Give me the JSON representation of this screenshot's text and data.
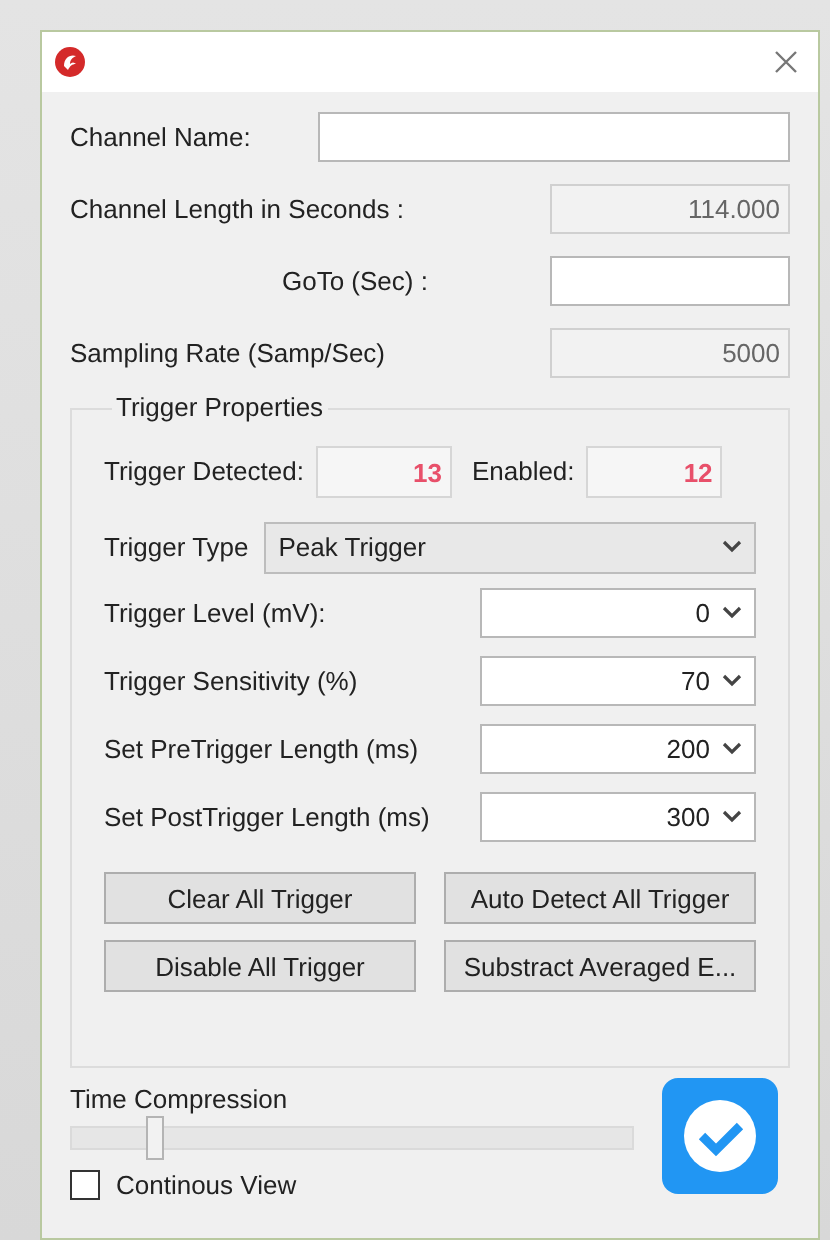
{
  "fields": [
    {
      "label": "Channel Name:",
      "readonly": false,
      "kind": "wide"
    },
    {
      "label": "Channel Length in Seconds :",
      "value": "114.000",
      "readonly": true,
      "kind": "short"
    },
    {
      "label": "GoTo (Sec) :",
      "readonly": false,
      "kind": "indented"
    },
    {
      "label": "Sampling Rate (Samp/Sec)",
      "value": "5000",
      "readonly": true,
      "kind": "short"
    }
  ],
  "trigger_properties": {
    "title": "Trigger Properties",
    "counters": [
      {
        "label": "Trigger Detected:",
        "value": "13"
      },
      {
        "label": "Enabled:",
        "value": "12"
      }
    ],
    "trigger_type": {
      "label": "Trigger Type",
      "value": "Peak Trigger"
    },
    "spinners": [
      {
        "label": "Trigger Level (mV):",
        "value": "0"
      },
      {
        "label": "Trigger Sensitivity (%)",
        "value": "70"
      },
      {
        "label": "Set PreTrigger Length (ms)",
        "value": "200"
      },
      {
        "label": "Set PostTrigger Length (ms)",
        "value": "300"
      }
    ],
    "buttons": [
      "Clear All Trigger",
      "Auto Detect All Trigger",
      "Disable All Trigger",
      "Substract Averaged E..."
    ]
  },
  "time_compression": {
    "label": "Time Compression",
    "level": 0.15
  },
  "continous_view": {
    "label": "Continous View",
    "checked": false
  }
}
